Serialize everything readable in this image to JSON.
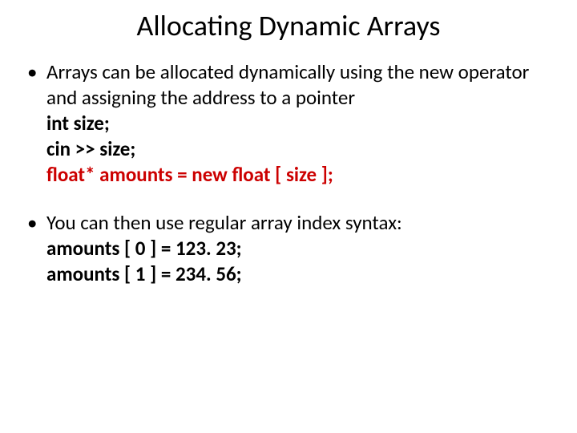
{
  "title": "Allocating Dynamic Arrays",
  "bullets": [
    {
      "text": "Arrays can be allocated dynamically using the new operator and assigning the address to a pointer",
      "code": [
        "int size;",
        "cin >> size;"
      ],
      "highlight": "float* amounts = new float [ size ];"
    },
    {
      "text": "You can then use regular array index syntax:",
      "code": [
        "amounts [ 0 ] = 123. 23;",
        "amounts [ 1 ] = 234. 56;"
      ]
    }
  ]
}
